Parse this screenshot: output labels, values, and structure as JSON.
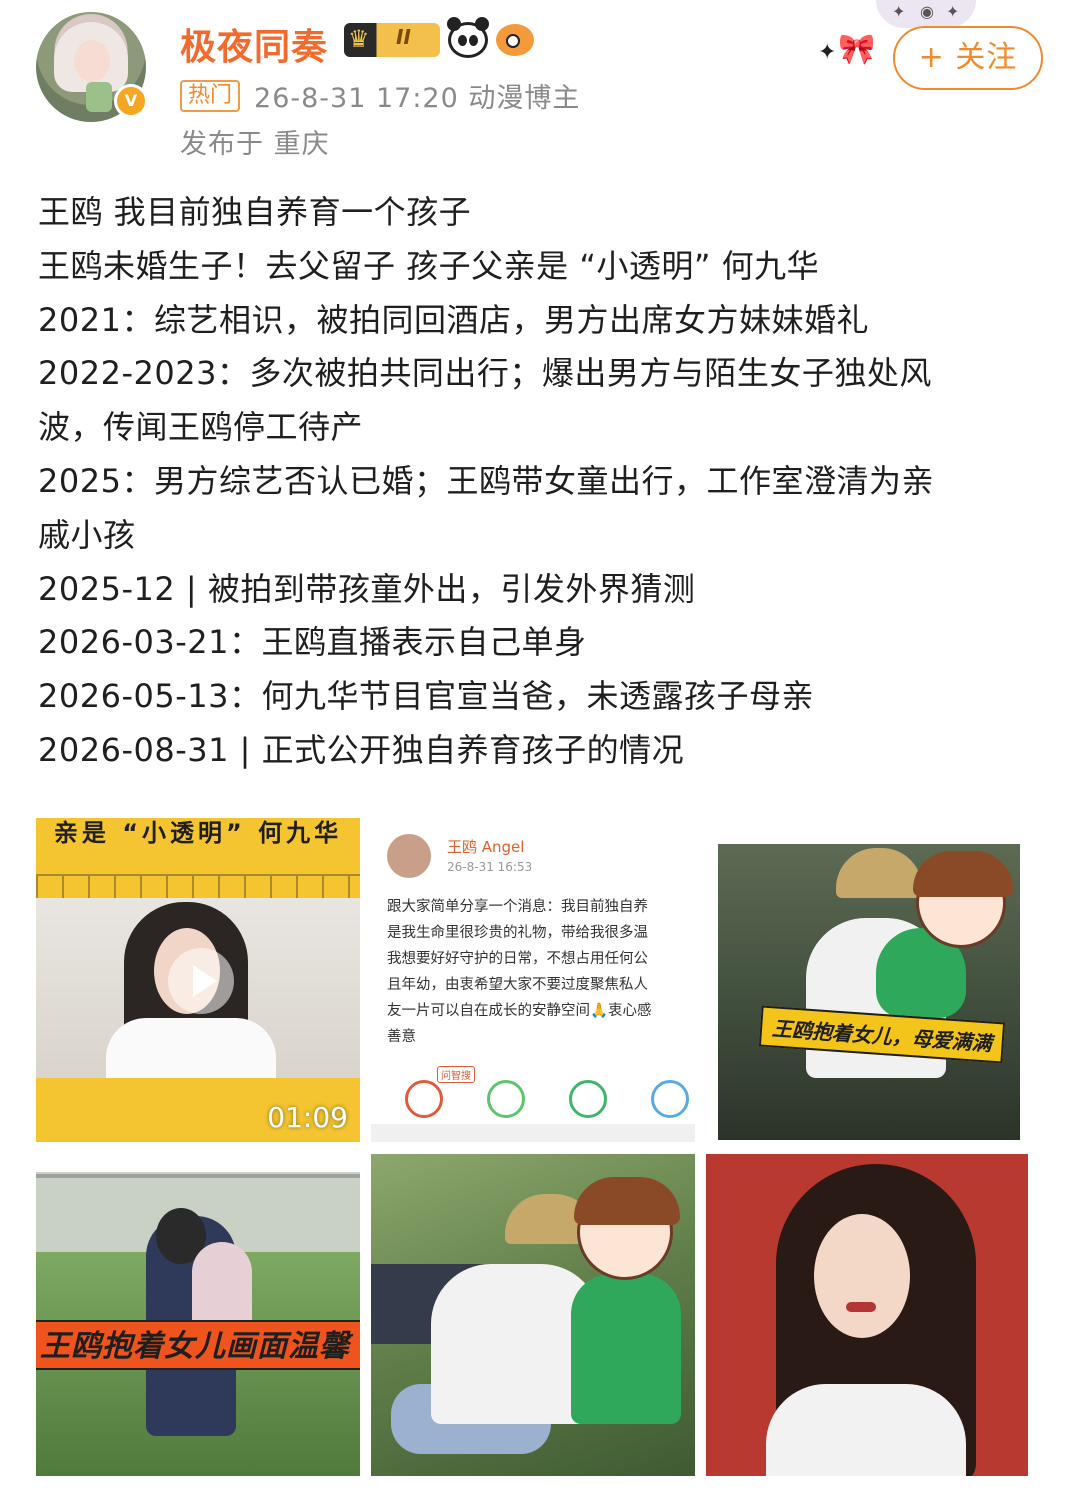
{
  "header": {
    "username": "极夜同奏",
    "level_badge": "II",
    "hot_tag": "热门",
    "meta": "26-8-31 17:20  动漫博主",
    "location": "发布于 重庆",
    "follow_label": "+ 关注"
  },
  "post": {
    "lines": [
      "王鸥 我目前独自养育一个孩子",
      "王鸥未婚生子！去父留子 孩子父亲是 “小透明” 何九华",
      "2021：综艺相识，被拍同回酒店，男方出席女方妹妹婚礼",
      "2022-2023：多次被拍共同出行；爆出男方与陌生女子独处风",
      "波，传闻王鸥停工待产",
      "2025：男方综艺否认已婚；王鸥带女童出行，工作室澄清为亲",
      "戚小孩",
      "2025-12 | 被拍到带孩童外出，引发外界猜测",
      "2026-03-21：王鸥直播表示自己单身",
      "2026-05-13：何九华节目官宣当爸，未透露孩子母亲",
      "2026-08-31 | 正式公开独自养育孩子的情况"
    ]
  },
  "images": {
    "video": {
      "banner": "亲是 “小透明” 何九华",
      "duration": "01:09"
    },
    "screenshot": {
      "name": "王鸥 Angel",
      "time": "26-8-31 16:53",
      "lines": [
        "跟大家简单分享一个消息：我目前独自养",
        "是我生命里很珍贵的礼物，带给我很多温",
        "我想要好好守护的日常，不想占用任何公",
        "且年幼，由衷希望大家不要过度聚焦私人",
        "友一片可以自在成长的安静空间🙏衷心感",
        "善意"
      ],
      "tag": "问智搜"
    },
    "photo3_label": "王鸥抱着女儿，母爱满满",
    "photo4_label": "王鸥抱着女儿画面温馨"
  },
  "colors": {
    "accent": "#f08a2c",
    "username": "#f26a2e"
  }
}
